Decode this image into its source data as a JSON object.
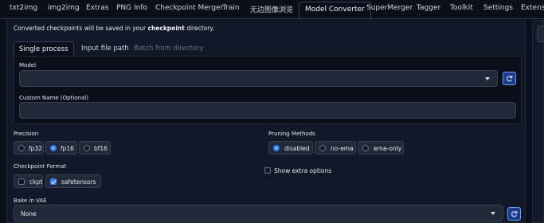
{
  "tabs": [
    "txt2img",
    "img2img",
    "Extras",
    "PNG Info",
    "Checkpoint Merger",
    "Train",
    "无边图像浏览",
    "Model Converter",
    "SuperMerger",
    "Tagger",
    "Toolkit",
    "Settings",
    "Extensio"
  ],
  "active_tab": "Model Converter",
  "info": {
    "prefix": "Converted checkpoints will be saved in your ",
    "bold": "checkpoint",
    "suffix": " directory."
  },
  "subtabs": [
    "Single process",
    "Input file path",
    "Batch from directory"
  ],
  "model": {
    "label": "Model",
    "value": ""
  },
  "custom_name": {
    "label": "Custom Name (Optional)",
    "value": ""
  },
  "precision": {
    "label": "Precision",
    "options": [
      "fp32",
      "fp16",
      "bf16"
    ],
    "selected": "fp16"
  },
  "pruning": {
    "label": "Pruning Methods",
    "options": [
      "disabled",
      "no-ema",
      "ema-only"
    ],
    "selected": "disabled"
  },
  "checkpoint_format": {
    "label": "Checkpoint Format",
    "options": [
      "ckpt",
      "safetensors"
    ],
    "checked": [
      "safetensors"
    ]
  },
  "show_extra": {
    "label": "Show extra options",
    "checked": false
  },
  "bake_vae": {
    "label": "Bake in VAE",
    "value": "None"
  },
  "colors": {
    "background": "#0b0f19",
    "accent": "#3b82f6",
    "panel": "#111827",
    "field": "#1f2937"
  },
  "icons": {
    "refresh": "refresh-icon",
    "dropdown": "chevron-down-icon"
  }
}
